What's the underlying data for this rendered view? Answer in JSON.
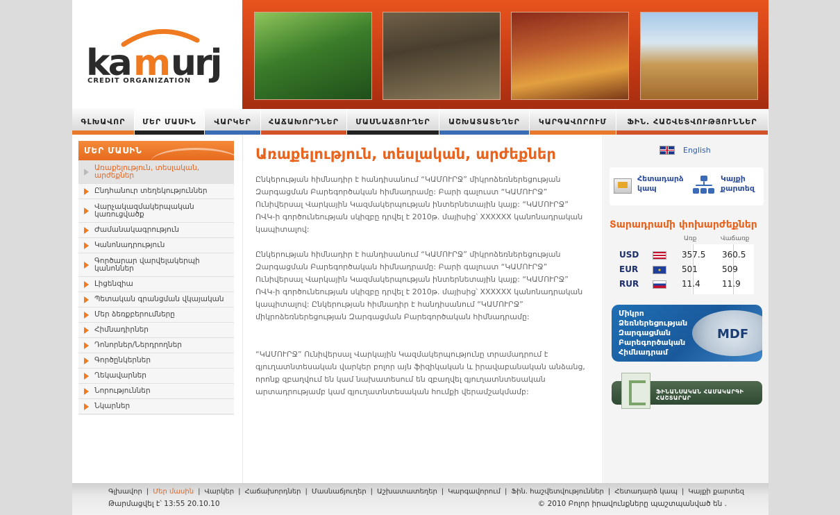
{
  "logo": {
    "brand": "kamurj",
    "sub": "CREDIT ORGANIZATION"
  },
  "nav": [
    {
      "label": "ԳԼԽԱՎՈՐ",
      "bar": "#e8782a",
      "active": false,
      "width": 90
    },
    {
      "label": "ՄԵՐ ՄԱՍԻՆ",
      "bar": "#222222",
      "active": true,
      "width": 101
    },
    {
      "label": "ՎԱՐԿԵՐ",
      "bar": "#3a6db3",
      "active": false,
      "width": 81
    },
    {
      "label": "ՀԱՃԱԽՈՐԴՆԵՐ",
      "bar": "#d2522a",
      "active": false,
      "width": 124
    },
    {
      "label": "ՄԱՍՆԱՃՅՈՒՂԵՐ",
      "bar": "#222222",
      "active": false,
      "width": 133
    },
    {
      "label": "ԱՇԽԱՏԱՏԵՂԵՐ",
      "bar": "#3a6db3",
      "active": false,
      "width": 130
    },
    {
      "label": "ԿԱՐԳԱՎՈՐՈՒՄ",
      "bar": "#e8782a",
      "active": false,
      "width": 125
    },
    {
      "label": "ՖԻՆ. ՀԱՇՎԵՏՎՈՒԹՅՈՒՆՆԵՐ",
      "bar": "#d2522a",
      "active": false,
      "width": 219
    }
  ],
  "sidebar": {
    "title": "ՄԵՐ ՄԱՍԻՆ",
    "items": [
      "Առաքելություն, տեսլական, արժեքներ",
      "Ընդհանուր տեղեկություններ",
      "Վարչակազմակերպական կառուցվածք",
      "Ժամանակագրություն",
      "Կանոնադրություն",
      "Գործարար վարվելակերպի կանոններ",
      "Լիցենզիա",
      "Պետական գրանցման վկայական",
      "Մեր ձեռքբերումները",
      "Հիմնադիրներ",
      "Դոնորներ/Ներդրողներ",
      "Գործընկերներ",
      "Ղեկավարներ",
      "Նորություններ",
      "Նկարներ"
    ]
  },
  "main": {
    "title": "Առաքելություն, տեսլական, արժեքներ",
    "paragraphs": [
      "Ընկերության հիմնադիր է հանդիսանում “ԿԱՄՈՒՐՋ” միկրոձեռներեցության Զարգացման Բարեգործական հիմնադրամը: Բարի գալուստ “ԿԱՄՈՒՐՋ” Ունիվերսալ Վարկային Կազմակերպության ինտերնետային կայք: “ԿԱՄՈՒՐՋ” ՈՎԿ-ի գործունեության սկիզբը դրվել է 2010թ. մայիսից՝ XXXXXX կանոնադրական կապիտալով:",
      "Ընկերության հիմնադիր է հանդիսանում “ԿԱՄՈՒՐՋ” միկրոձեռներեցության Զարգացման Բարեգործական հիմնադրամը: Բարի գալուստ “ԿԱՄՈՒՐՋ” Ունիվերսալ Վարկային Կազմակերպության ինտերնետային կայք: “ԿԱՄՈՒՐՋ” ՈՎԿ-ի գործունեության սկիզբը դրվել է 2010թ. մայիսից՝ XXXXXX կանոնադրական կապիտալով: Ընկերության հիմնադիր է հանդիսանում “ԿԱՄՈՒՐՋ” միկրոձեռներեցության Զարգացման Բարեգործական հիմնադրամը:",
      "“ԿԱՄՈՒՐՋ” Ունիվերսալ Վարկային Կազմակերպությունը տրամադրում է գյուղատնտեսական վարկեր բոլոր այն ֆիզիկական և իրավաբանական անձանց, որոնք զբաղվում են կամ նախատեսում են զբաղվել գյուղատնտեսական արտադրությամբ կամ գյուղատնտեսական հումքի վերամշակմամբ:"
    ]
  },
  "right": {
    "language": "English",
    "feedback": "Հետադարձ կապ",
    "sitemap": "Կայքի քարտեզ",
    "rates_title": "Տարադրամի փոխարժեքներ",
    "buy_label": "Առք",
    "sell_label": "Վաճառք",
    "rates": [
      {
        "code": "USD",
        "buy": "357.5",
        "sell": "360.5",
        "flag": "us"
      },
      {
        "code": "EUR",
        "buy": "501",
        "sell": "509",
        "flag": "eu"
      },
      {
        "code": "RUR",
        "buy": "11.4",
        "sell": "11.9",
        "flag": "ru"
      }
    ],
    "mdf_text": "Միկրո Ձեռներեցության Զարգացման Բարեգործական Հիմնադրամ",
    "mdf_logo": "MDF",
    "fin_label": "ՖԻՆԱՆՍԱԿԱՆ ՀԱՄԱԿԱՐԳԻ ՀԱՇՏԱՐԱՐ"
  },
  "footer": {
    "links": [
      "Գլխավոր",
      "Մեր մասին",
      "Վարկեր",
      "Հաճախորդներ",
      "Մասնաճյուղեր",
      "Աշխատատեղեր",
      "Կարգավորում",
      "Ֆին. հաշվետվություններ",
      "Հետադարձ կապ",
      "Կայքի քարտեզ"
    ],
    "active_index": 1,
    "updated": "Թարմացվել է՝ 13:55  20.10.10",
    "copyright": "© 2010 Բոլոր իրավունքները պաշտպանված են ."
  }
}
